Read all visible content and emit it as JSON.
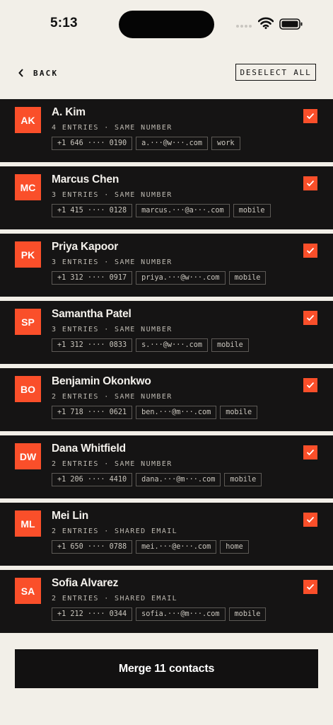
{
  "status_bar": {
    "time": "5:13"
  },
  "header": {
    "back_label": "BACK",
    "deselect_label": "DESELECT ALL"
  },
  "colors": {
    "accent": "#fa4f2a",
    "background": "#f2efe8",
    "card": "#151414"
  },
  "contacts": [
    {
      "initials": "AK",
      "name": "A. Kim",
      "meta": "4 ENTRIES · SAME NUMBER",
      "phone": "+1 646 ···· 0190",
      "email": "a.···@w···.com",
      "label": "work",
      "checked": true
    },
    {
      "initials": "MC",
      "name": "Marcus Chen",
      "meta": "3 ENTRIES · SAME NUMBER",
      "phone": "+1 415 ···· 0128",
      "email": "marcus.···@a···.com",
      "label": "mobile",
      "checked": true
    },
    {
      "initials": "PK",
      "name": "Priya Kapoor",
      "meta": "3 ENTRIES · SAME NUMBER",
      "phone": "+1 312 ···· 0917",
      "email": "priya.···@w···.com",
      "label": "mobile",
      "checked": true
    },
    {
      "initials": "SP",
      "name": "Samantha Patel",
      "meta": "3 ENTRIES · SAME NUMBER",
      "phone": "+1 312 ···· 0833",
      "email": "s.···@w···.com",
      "label": "mobile",
      "checked": true
    },
    {
      "initials": "BO",
      "name": "Benjamin Okonkwo",
      "meta": "2 ENTRIES · SAME NUMBER",
      "phone": "+1 718 ···· 0621",
      "email": "ben.···@m···.com",
      "label": "mobile",
      "checked": true
    },
    {
      "initials": "DW",
      "name": "Dana Whitfield",
      "meta": "2 ENTRIES · SAME NUMBER",
      "phone": "+1 206 ···· 4410",
      "email": "dana.···@m···.com",
      "label": "mobile",
      "checked": true
    },
    {
      "initials": "ML",
      "name": "Mei Lin",
      "meta": "2 ENTRIES · SHARED EMAIL",
      "phone": "+1 650 ···· 0788",
      "email": "mei.···@e···.com",
      "label": "home",
      "checked": true
    },
    {
      "initials": "SA",
      "name": "Sofia Alvarez",
      "meta": "2 ENTRIES · SHARED EMAIL",
      "phone": "+1 212 ···· 0344",
      "email": "sofia.···@m···.com",
      "label": "mobile",
      "checked": true
    }
  ],
  "footer": {
    "merge_label": "Merge 11 contacts"
  }
}
